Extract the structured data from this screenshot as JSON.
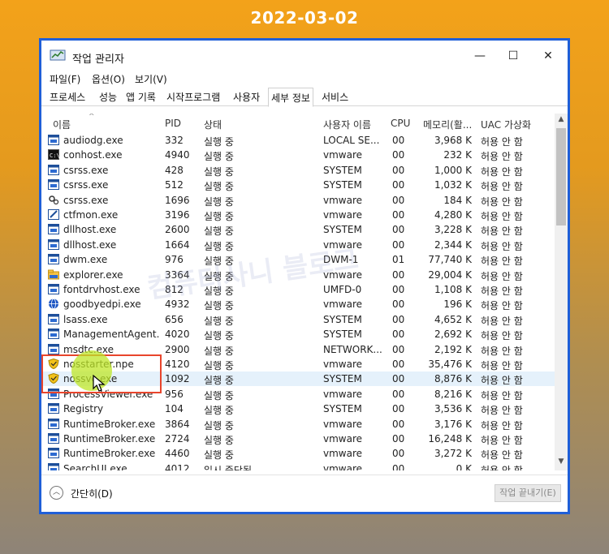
{
  "caption": "2022-03-02",
  "window": {
    "title": "작업 관리자",
    "controls": {
      "minimize": "—",
      "maximize": "☐",
      "close": "✕"
    }
  },
  "menu": [
    "파일(F)",
    "옵션(O)",
    "보기(V)"
  ],
  "tabs": [
    {
      "label": "프로세스",
      "active": false
    },
    {
      "label": "성능",
      "active": false
    },
    {
      "label": "앱 기록",
      "active": false
    },
    {
      "label": "시작프로그램",
      "active": false
    },
    {
      "label": "사용자",
      "active": false
    },
    {
      "label": "세부 정보",
      "active": true
    },
    {
      "label": "서비스",
      "active": false
    }
  ],
  "columns": {
    "name": "이름",
    "pid": "PID",
    "status": "상태",
    "user": "사용자 이름",
    "cpu": "CPU",
    "memory": "메모리(활...",
    "uac": "UAC 가상화"
  },
  "rows": [
    {
      "icon": "window-app-icon",
      "name": "audiodg.exe",
      "pid": "332",
      "status": "실행 중",
      "user": "LOCAL SE...",
      "cpu": "00",
      "memory": "3,968 K",
      "uac": "허용 안 함"
    },
    {
      "icon": "console-icon",
      "name": "conhost.exe",
      "pid": "4940",
      "status": "실행 중",
      "user": "vmware",
      "cpu": "00",
      "memory": "232 K",
      "uac": "허용 안 함"
    },
    {
      "icon": "window-app-icon",
      "name": "csrss.exe",
      "pid": "428",
      "status": "실행 중",
      "user": "SYSTEM",
      "cpu": "00",
      "memory": "1,000 K",
      "uac": "허용 안 함"
    },
    {
      "icon": "window-app-icon",
      "name": "csrss.exe",
      "pid": "512",
      "status": "실행 중",
      "user": "SYSTEM",
      "cpu": "00",
      "memory": "1,032 K",
      "uac": "허용 안 함"
    },
    {
      "icon": "gear-app-icon",
      "name": "csrss.exe",
      "pid": "1696",
      "status": "실행 중",
      "user": "vmware",
      "cpu": "00",
      "memory": "184 K",
      "uac": "허용 안 함"
    },
    {
      "icon": "pen-app-icon",
      "name": "ctfmon.exe",
      "pid": "3196",
      "status": "실행 중",
      "user": "vmware",
      "cpu": "00",
      "memory": "4,280 K",
      "uac": "허용 안 함"
    },
    {
      "icon": "window-app-icon",
      "name": "dllhost.exe",
      "pid": "2600",
      "status": "실행 중",
      "user": "SYSTEM",
      "cpu": "00",
      "memory": "3,228 K",
      "uac": "허용 안 함"
    },
    {
      "icon": "window-app-icon",
      "name": "dllhost.exe",
      "pid": "1664",
      "status": "실행 중",
      "user": "vmware",
      "cpu": "00",
      "memory": "2,344 K",
      "uac": "허용 안 함"
    },
    {
      "icon": "window-app-icon",
      "name": "dwm.exe",
      "pid": "976",
      "status": "실행 중",
      "user": "DWM-1",
      "cpu": "01",
      "memory": "77,740 K",
      "uac": "허용 안 함"
    },
    {
      "icon": "folder-app-icon",
      "name": "explorer.exe",
      "pid": "3364",
      "status": "실행 중",
      "user": "vmware",
      "cpu": "00",
      "memory": "29,004 K",
      "uac": "허용 안 함"
    },
    {
      "icon": "window-app-icon",
      "name": "fontdrvhost.exe",
      "pid": "812",
      "status": "실행 중",
      "user": "UMFD-0",
      "cpu": "00",
      "memory": "1,108 K",
      "uac": "허용 안 함"
    },
    {
      "icon": "globe-app-icon",
      "name": "goodbyedpi.exe",
      "pid": "4932",
      "status": "실행 중",
      "user": "vmware",
      "cpu": "00",
      "memory": "196 K",
      "uac": "허용 안 함"
    },
    {
      "icon": "window-app-icon",
      "name": "lsass.exe",
      "pid": "656",
      "status": "실행 중",
      "user": "SYSTEM",
      "cpu": "00",
      "memory": "4,652 K",
      "uac": "허용 안 함"
    },
    {
      "icon": "window-app-icon",
      "name": "ManagementAgent...",
      "pid": "4020",
      "status": "실행 중",
      "user": "SYSTEM",
      "cpu": "00",
      "memory": "2,692 K",
      "uac": "허용 안 함"
    },
    {
      "icon": "window-app-icon",
      "name": "msdtc.exe",
      "pid": "2900",
      "status": "실행 중",
      "user": "NETWORK...",
      "cpu": "00",
      "memory": "2,192 K",
      "uac": "허용 안 함"
    },
    {
      "icon": "shield-app-icon",
      "name": "nosstarter.npe",
      "pid": "4120",
      "status": "실행 중",
      "user": "vmware",
      "cpu": "00",
      "memory": "35,476 K",
      "uac": "허용 안 함"
    },
    {
      "icon": "shield-app-icon",
      "name": "nossvc.exe",
      "pid": "1092",
      "status": "실행 중",
      "user": "SYSTEM",
      "cpu": "00",
      "memory": "8,876 K",
      "uac": "허용 안 함",
      "selected": true
    },
    {
      "icon": "window-app-icon",
      "name": "ProcessViewer.exe",
      "pid": "956",
      "status": "실행 중",
      "user": "vmware",
      "cpu": "00",
      "memory": "8,216 K",
      "uac": "허용 안 함"
    },
    {
      "icon": "window-app-icon",
      "name": "Registry",
      "pid": "104",
      "status": "실행 중",
      "user": "SYSTEM",
      "cpu": "00",
      "memory": "3,536 K",
      "uac": "허용 안 함"
    },
    {
      "icon": "window-app-icon",
      "name": "RuntimeBroker.exe",
      "pid": "3864",
      "status": "실행 중",
      "user": "vmware",
      "cpu": "00",
      "memory": "3,176 K",
      "uac": "허용 안 함"
    },
    {
      "icon": "window-app-icon",
      "name": "RuntimeBroker.exe",
      "pid": "2724",
      "status": "실행 중",
      "user": "vmware",
      "cpu": "00",
      "memory": "16,248 K",
      "uac": "허용 안 함"
    },
    {
      "icon": "window-app-icon",
      "name": "RuntimeBroker.exe",
      "pid": "4460",
      "status": "실행 중",
      "user": "vmware",
      "cpu": "00",
      "memory": "3,272 K",
      "uac": "허용 안 함"
    },
    {
      "icon": "window-app-icon",
      "name": "SearchUI.exe",
      "pid": "4012",
      "status": "일시 중단됨",
      "user": "vmware",
      "cpu": "00",
      "memory": "0 K",
      "uac": "허용 안 함"
    }
  ],
  "footer": {
    "fewer_details": "간단히(D)",
    "end_task": "작업 끝내기(E)"
  },
  "watermark": "컴퓨터사니 블로그",
  "colors": {
    "accent": "#1f5fd8",
    "highlight": "#e8452c",
    "selected_row": "#e5f1fb"
  }
}
